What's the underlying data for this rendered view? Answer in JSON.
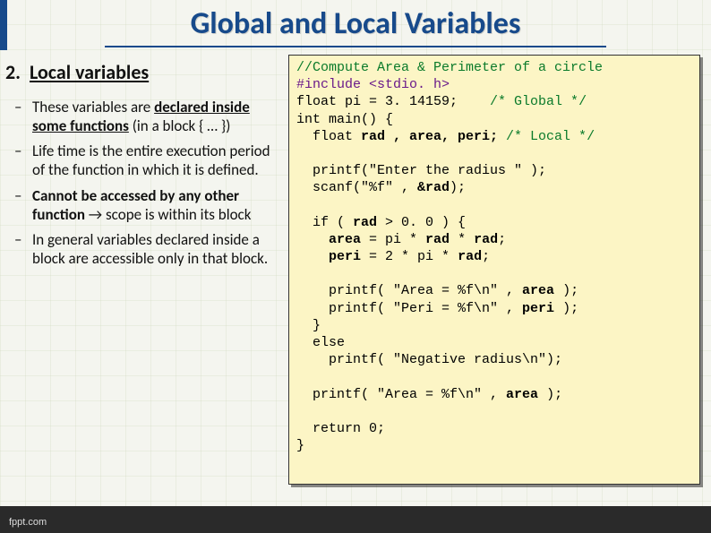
{
  "title": "Global  and Local Variables",
  "section": {
    "number": "2.",
    "label": "Local variables"
  },
  "bullets": [
    {
      "pre": "These variables are ",
      "bold_u": "declared inside some functions",
      "post": " (in a block { … })"
    },
    {
      "pre": "Life time is the entire execution period of the function in which it is defined.",
      "bold_u": "",
      "post": ""
    },
    {
      "pre": "",
      "bold_u": "",
      "full_bold": "Cannot be accessed by any other function",
      "arrow": " → ",
      "post": "scope is within its block"
    },
    {
      "pre": "In general variables declared inside a block are accessible only in that block.",
      "bold_u": "",
      "post": ""
    }
  ],
  "code": {
    "l1_comment": "//Compute Area & Perimeter of a circle",
    "l2_include": "#include <stdio. h>",
    "l3a": "float pi = 3. 14159;    ",
    "l3b": "/* Global */",
    "l4": "int main() {",
    "l5a": "  float ",
    "l5b": "rad , area, peri;",
    "l5c": " /* Local */",
    "blank1": "",
    "l6": "  printf(\"Enter the radius \" );",
    "l7a": "  scanf(\"%f\" , ",
    "l7b": "&rad",
    "l7c": ");",
    "blank2": "",
    "l8a": "  if ( ",
    "l8b": "rad",
    "l8c": " > 0. 0 ) {",
    "l9a": "    ",
    "l9b": "area",
    "l9c": " = pi * ",
    "l9d": "rad",
    "l9e": " * ",
    "l9f": "rad",
    "l9g": ";",
    "l10a": "    ",
    "l10b": "peri",
    "l10c": " = 2 * pi * ",
    "l10d": "rad",
    "l10e": ";",
    "blank3": "",
    "l11a": "    printf( \"Area = %f\\n\" , ",
    "l11b": "area",
    "l11c": " );",
    "l12a": "    printf( \"Peri = %f\\n\" , ",
    "l12b": "peri",
    "l12c": " );",
    "l13": "  }",
    "l14": "  else",
    "l15": "    printf( \"Negative radius\\n\");",
    "blank4": "",
    "l16a": "  printf( \"Area = %f\\n\" , ",
    "l16b": "area",
    "l16c": " );",
    "blank5": "",
    "l17": "  return 0;",
    "l18": "}"
  },
  "watermark": "fppt.com"
}
